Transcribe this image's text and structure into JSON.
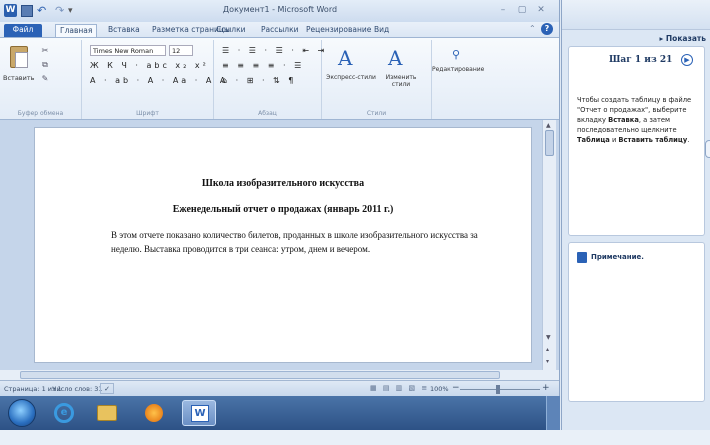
{
  "window": {
    "title": "Документ1 - Microsoft Word"
  },
  "quick_access": {
    "app_icon": "word-icon",
    "save": "save-icon",
    "undo": "↶",
    "redo": "↷",
    "more": "▾"
  },
  "window_controls": {
    "minimize": "–",
    "maximize": "▢",
    "close": "✕"
  },
  "tabs": [
    {
      "label": "Файл"
    },
    {
      "label": "Главная"
    },
    {
      "label": "Вставка"
    },
    {
      "label": "Разметка страницы"
    },
    {
      "label": "Ссылки"
    },
    {
      "label": "Рассылки"
    },
    {
      "label": "Рецензирование"
    },
    {
      "label": "Вид"
    }
  ],
  "ribbon": {
    "clipboard": {
      "paste_label": "Вставить",
      "group_label": "Буфер обмена"
    },
    "font": {
      "name": "Times New Roman",
      "size": "12",
      "row1": "Ж К Ч · abc x₂ x²",
      "row2": "A · ab · A · Aa · A A",
      "group_label": "Шрифт"
    },
    "paragraph": {
      "row1": "☰ · ☰ · ☰ · ⇤ ⇥",
      "row2": "≡ ≡ ≡ ≡ · ☰",
      "row3": "⌂ · ⊞ · ⇅ ¶",
      "group_label": "Абзац"
    },
    "styles": {
      "express_label": "Экспресс-стили",
      "change_label": "Изменить стили",
      "group_label": "Стили"
    },
    "editing": {
      "label": "Редактирование"
    }
  },
  "document": {
    "heading": "Школа изобразительного искусства",
    "subheading": "Еженедельный отчет о продажах (январь 2011 г.)",
    "body": "В этом отчете показано количество билетов, проданных в школе изобразительного искусства за неделю. Выставка проводится в три сеанса: утром, днем и вечером."
  },
  "statusbar": {
    "page": "Страница: 1 из 1",
    "words": "Число слов: 31",
    "zoom": "100%"
  },
  "taskbar": {
    "items": [
      "start-button",
      "internet-explorer",
      "file-explorer",
      "media-player",
      "word"
    ],
    "word_glyph": "W"
  },
  "help_pane": {
    "show_label": "▸ Показать",
    "step": "Шаг 1 из 21",
    "instruction_parts": [
      "Чтобы создать таблицу в файле \"Отчет о продажах\", выберите вкладку ",
      "Вставка",
      ", а затем последовательно щелкните ",
      "Таблица",
      " и ",
      "Вставить таблицу",
      "."
    ],
    "notes_label": "Примечание."
  }
}
